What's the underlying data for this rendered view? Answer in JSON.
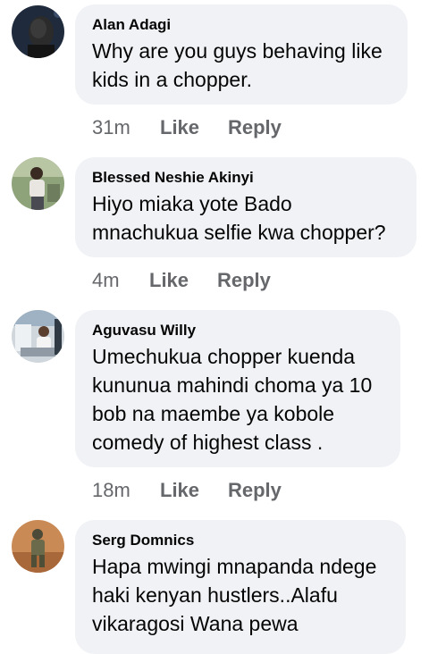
{
  "comments": [
    {
      "author": "Alan Adagi",
      "text": "Why are you guys behaving like kids in a chopper.",
      "time": "31m",
      "like_label": "Like",
      "reply_label": "Reply"
    },
    {
      "author": "Blessed Neshie Akinyi",
      "text": "Hiyo miaka yote Bado mnachukua selfie kwa chopper?",
      "time": "4m",
      "like_label": "Like",
      "reply_label": "Reply"
    },
    {
      "author": "Aguvasu Willy",
      "text": "Umechukua chopper kuenda kununua mahindi choma ya 10 bob na maembe ya kobole comedy of highest class .",
      "time": "18m",
      "like_label": "Like",
      "reply_label": "Reply"
    },
    {
      "author": "Serg Domnics",
      "text": "Hapa mwingi mnapanda ndege haki kenyan hustlers..Alafu vikaragosi Wana pewa",
      "time": "",
      "like_label": "",
      "reply_label": ""
    }
  ]
}
